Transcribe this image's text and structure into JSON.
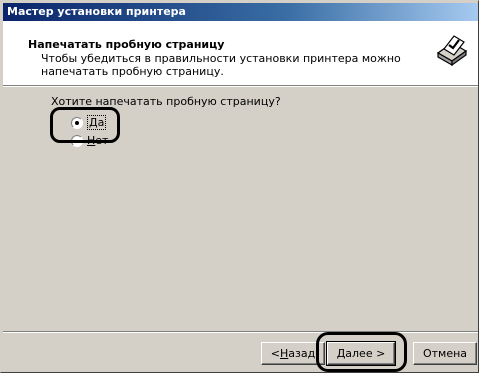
{
  "window": {
    "title": "Мастер установки принтера"
  },
  "header": {
    "title": "Напечатать пробную страницу",
    "subtitle": "Чтобы убедиться в правильности установки принтера можно напечатать пробную страницу.",
    "icon": "printer-check-icon"
  },
  "content": {
    "question": "Хотите напечатать пробную страницу?",
    "options": [
      {
        "label": "Да",
        "mnemonic": "Д",
        "rest": "а",
        "selected": true
      },
      {
        "label": "Нет",
        "mnemonic": "Н",
        "rest": "ет",
        "selected": false
      }
    ]
  },
  "buttons": {
    "back": {
      "prefix": "< ",
      "mnemonic": "Н",
      "rest": "азад"
    },
    "next": {
      "label": "Далее >"
    },
    "cancel": {
      "label": "Отмена"
    }
  }
}
